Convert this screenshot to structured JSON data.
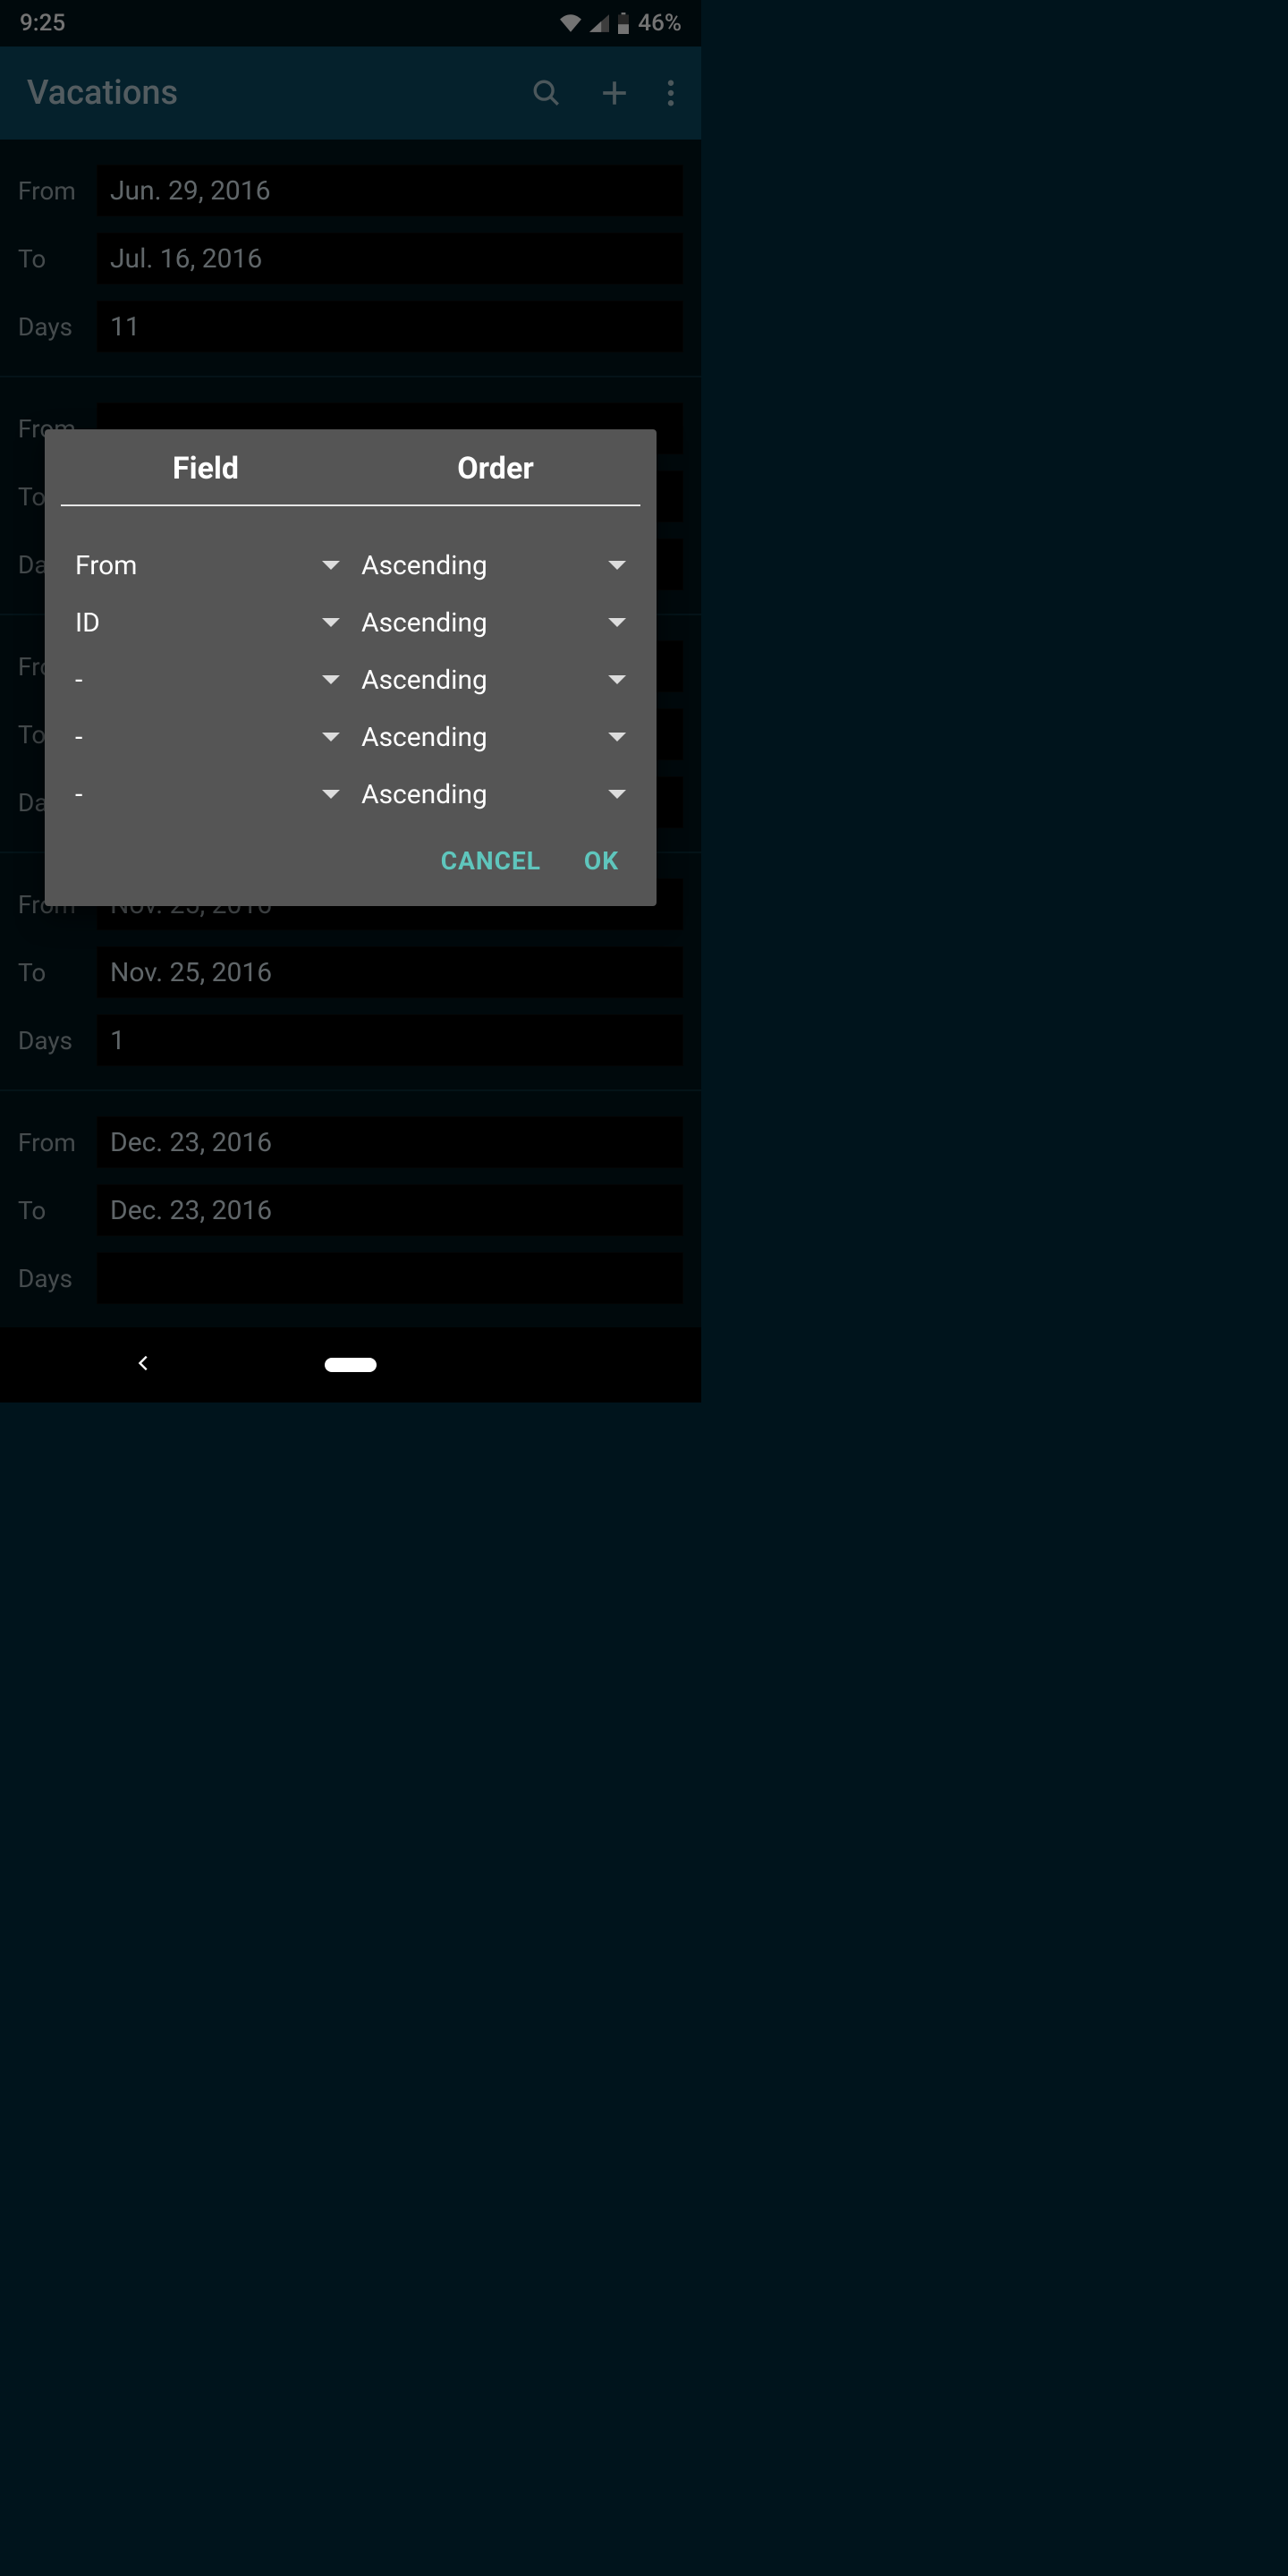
{
  "status": {
    "time": "9:25",
    "battery_pct": "46%"
  },
  "app_bar": {
    "title": "Vacations"
  },
  "labels": {
    "from": "From",
    "to": "To",
    "days": "Days"
  },
  "records": [
    {
      "from": "Jun. 29, 2016",
      "to": "Jul. 16, 2016",
      "days": "11"
    },
    {
      "from": "",
      "to": "",
      "days": ""
    },
    {
      "from": "",
      "to": "",
      "days": ""
    },
    {
      "from": "Nov. 25, 2016",
      "to": "Nov. 25, 2016",
      "days": "1"
    },
    {
      "from": "Dec. 23, 2016",
      "to": "Dec. 23, 2016",
      "days": ""
    }
  ],
  "dialog": {
    "header_field": "Field",
    "header_order": "Order",
    "rows": [
      {
        "field": "From",
        "order": "Ascending"
      },
      {
        "field": "ID",
        "order": "Ascending"
      },
      {
        "field": "-",
        "order": "Ascending"
      },
      {
        "field": "-",
        "order": "Ascending"
      },
      {
        "field": "-",
        "order": "Ascending"
      }
    ],
    "cancel": "CANCEL",
    "ok": "OK"
  }
}
